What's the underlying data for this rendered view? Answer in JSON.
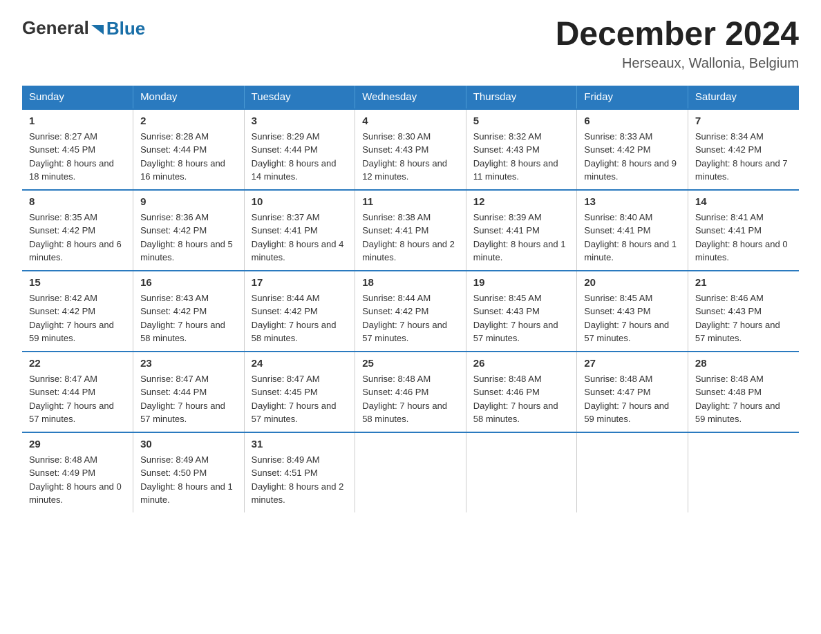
{
  "logo": {
    "general": "General",
    "blue": "Blue"
  },
  "title": {
    "month": "December 2024",
    "location": "Herseaux, Wallonia, Belgium"
  },
  "headers": [
    "Sunday",
    "Monday",
    "Tuesday",
    "Wednesday",
    "Thursday",
    "Friday",
    "Saturday"
  ],
  "weeks": [
    [
      {
        "day": "1",
        "sunrise": "8:27 AM",
        "sunset": "4:45 PM",
        "daylight": "8 hours and 18 minutes."
      },
      {
        "day": "2",
        "sunrise": "8:28 AM",
        "sunset": "4:44 PM",
        "daylight": "8 hours and 16 minutes."
      },
      {
        "day": "3",
        "sunrise": "8:29 AM",
        "sunset": "4:44 PM",
        "daylight": "8 hours and 14 minutes."
      },
      {
        "day": "4",
        "sunrise": "8:30 AM",
        "sunset": "4:43 PM",
        "daylight": "8 hours and 12 minutes."
      },
      {
        "day": "5",
        "sunrise": "8:32 AM",
        "sunset": "4:43 PM",
        "daylight": "8 hours and 11 minutes."
      },
      {
        "day": "6",
        "sunrise": "8:33 AM",
        "sunset": "4:42 PM",
        "daylight": "8 hours and 9 minutes."
      },
      {
        "day": "7",
        "sunrise": "8:34 AM",
        "sunset": "4:42 PM",
        "daylight": "8 hours and 7 minutes."
      }
    ],
    [
      {
        "day": "8",
        "sunrise": "8:35 AM",
        "sunset": "4:42 PM",
        "daylight": "8 hours and 6 minutes."
      },
      {
        "day": "9",
        "sunrise": "8:36 AM",
        "sunset": "4:42 PM",
        "daylight": "8 hours and 5 minutes."
      },
      {
        "day": "10",
        "sunrise": "8:37 AM",
        "sunset": "4:41 PM",
        "daylight": "8 hours and 4 minutes."
      },
      {
        "day": "11",
        "sunrise": "8:38 AM",
        "sunset": "4:41 PM",
        "daylight": "8 hours and 2 minutes."
      },
      {
        "day": "12",
        "sunrise": "8:39 AM",
        "sunset": "4:41 PM",
        "daylight": "8 hours and 1 minute."
      },
      {
        "day": "13",
        "sunrise": "8:40 AM",
        "sunset": "4:41 PM",
        "daylight": "8 hours and 1 minute."
      },
      {
        "day": "14",
        "sunrise": "8:41 AM",
        "sunset": "4:41 PM",
        "daylight": "8 hours and 0 minutes."
      }
    ],
    [
      {
        "day": "15",
        "sunrise": "8:42 AM",
        "sunset": "4:42 PM",
        "daylight": "7 hours and 59 minutes."
      },
      {
        "day": "16",
        "sunrise": "8:43 AM",
        "sunset": "4:42 PM",
        "daylight": "7 hours and 58 minutes."
      },
      {
        "day": "17",
        "sunrise": "8:44 AM",
        "sunset": "4:42 PM",
        "daylight": "7 hours and 58 minutes."
      },
      {
        "day": "18",
        "sunrise": "8:44 AM",
        "sunset": "4:42 PM",
        "daylight": "7 hours and 57 minutes."
      },
      {
        "day": "19",
        "sunrise": "8:45 AM",
        "sunset": "4:43 PM",
        "daylight": "7 hours and 57 minutes."
      },
      {
        "day": "20",
        "sunrise": "8:45 AM",
        "sunset": "4:43 PM",
        "daylight": "7 hours and 57 minutes."
      },
      {
        "day": "21",
        "sunrise": "8:46 AM",
        "sunset": "4:43 PM",
        "daylight": "7 hours and 57 minutes."
      }
    ],
    [
      {
        "day": "22",
        "sunrise": "8:47 AM",
        "sunset": "4:44 PM",
        "daylight": "7 hours and 57 minutes."
      },
      {
        "day": "23",
        "sunrise": "8:47 AM",
        "sunset": "4:44 PM",
        "daylight": "7 hours and 57 minutes."
      },
      {
        "day": "24",
        "sunrise": "8:47 AM",
        "sunset": "4:45 PM",
        "daylight": "7 hours and 57 minutes."
      },
      {
        "day": "25",
        "sunrise": "8:48 AM",
        "sunset": "4:46 PM",
        "daylight": "7 hours and 58 minutes."
      },
      {
        "day": "26",
        "sunrise": "8:48 AM",
        "sunset": "4:46 PM",
        "daylight": "7 hours and 58 minutes."
      },
      {
        "day": "27",
        "sunrise": "8:48 AM",
        "sunset": "4:47 PM",
        "daylight": "7 hours and 59 minutes."
      },
      {
        "day": "28",
        "sunrise": "8:48 AM",
        "sunset": "4:48 PM",
        "daylight": "7 hours and 59 minutes."
      }
    ],
    [
      {
        "day": "29",
        "sunrise": "8:48 AM",
        "sunset": "4:49 PM",
        "daylight": "8 hours and 0 minutes."
      },
      {
        "day": "30",
        "sunrise": "8:49 AM",
        "sunset": "4:50 PM",
        "daylight": "8 hours and 1 minute."
      },
      {
        "day": "31",
        "sunrise": "8:49 AM",
        "sunset": "4:51 PM",
        "daylight": "8 hours and 2 minutes."
      },
      null,
      null,
      null,
      null
    ]
  ],
  "labels": {
    "sunrise": "Sunrise:",
    "sunset": "Sunset:",
    "daylight": "Daylight:"
  }
}
